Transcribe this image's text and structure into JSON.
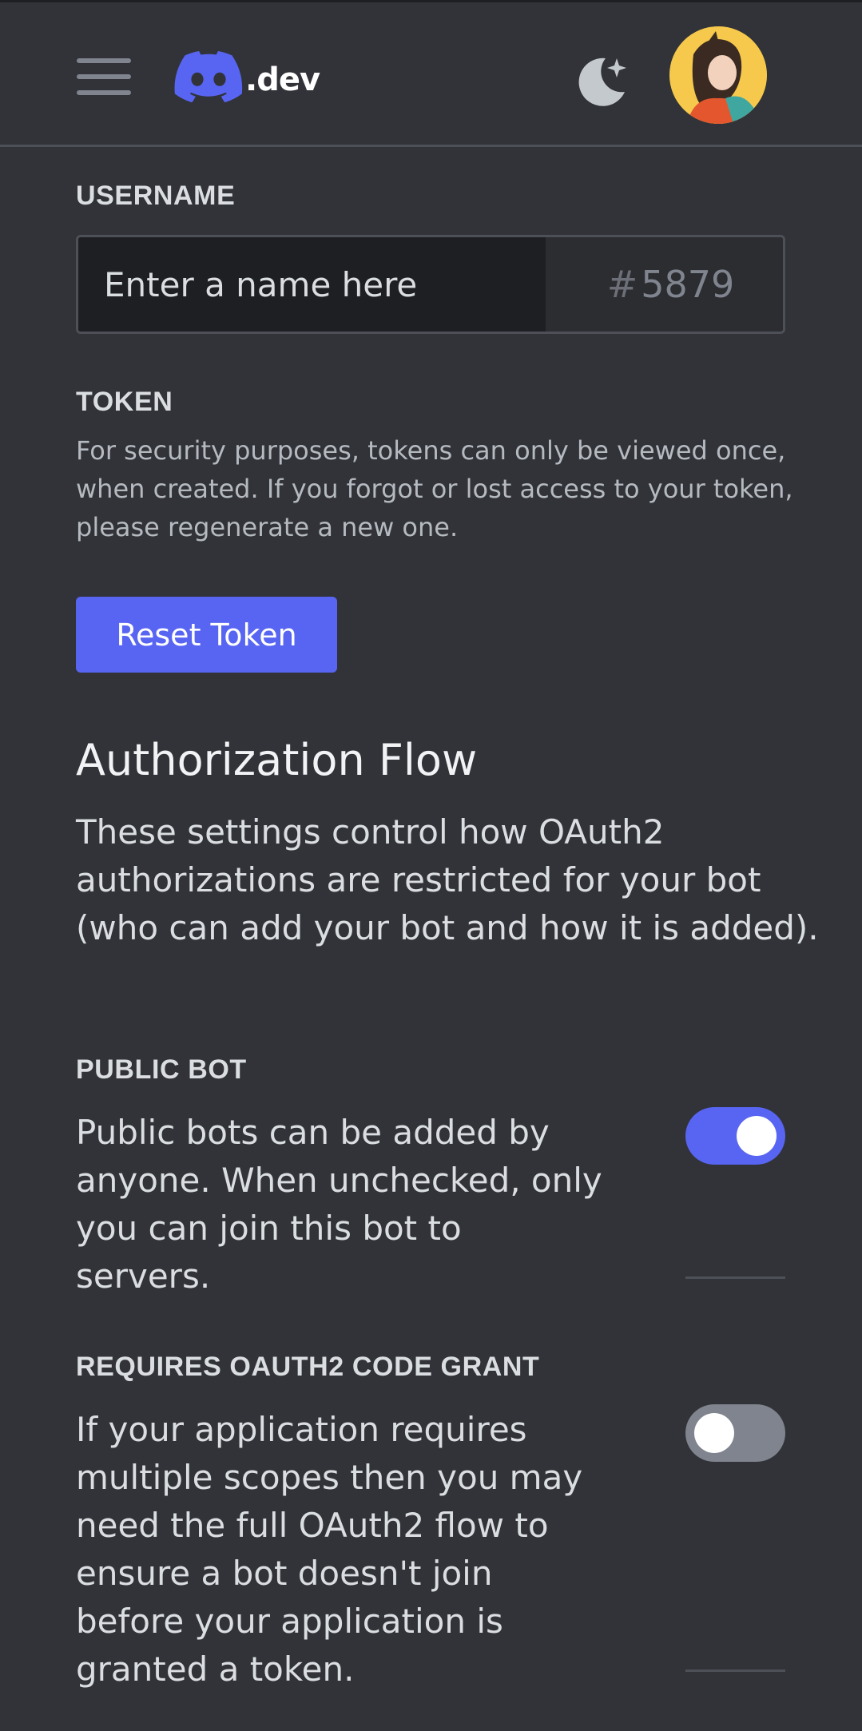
{
  "header": {
    "logo_text": ".dev",
    "menu_icon": "hamburger-menu-icon",
    "theme_icon": "moon-sparkle-icon",
    "avatar": "user-avatar"
  },
  "username": {
    "label": "USERNAME",
    "placeholder": "Enter a name here",
    "value": "",
    "discriminator_hash": "#",
    "discriminator": "5879"
  },
  "token": {
    "label": "TOKEN",
    "description": "For security purposes, tokens can only be viewed once, when created. If you forgot or lost access to your token, please regenerate a new one.",
    "reset_button": "Reset Token"
  },
  "authorization_flow": {
    "title": "Authorization Flow",
    "description": "These settings control how OAuth2 authorizations are restricted for your bot (who can add your bot and how it is added)."
  },
  "settings": [
    {
      "label": "PUBLIC BOT",
      "description": "Public bots can be added by anyone. When unchecked, only you can join this bot to servers.",
      "enabled": true
    },
    {
      "label": "REQUIRES OAUTH2 CODE GRANT",
      "description": "If your application requires multiple scopes then you may need the full OAuth2 flow to ensure a bot doesn't join before your application is granted a token.",
      "enabled": false
    }
  ],
  "colors": {
    "background": "#313338",
    "accent": "#5865f2",
    "toggle_off": "#80848e"
  }
}
